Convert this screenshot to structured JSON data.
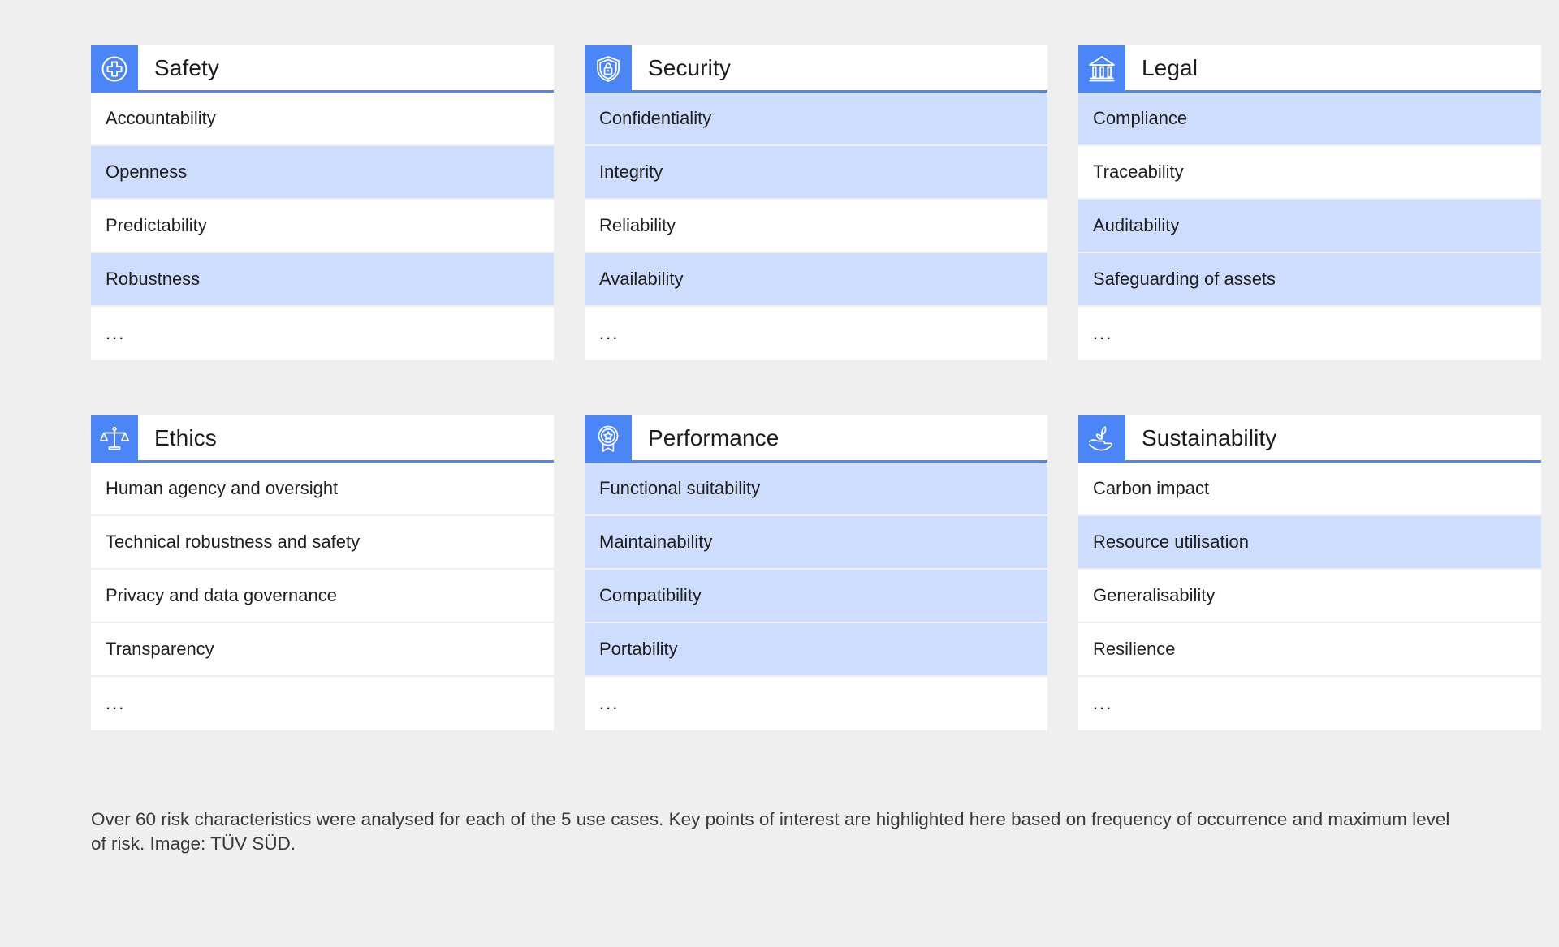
{
  "theme": {
    "background": "#efefef",
    "accent_blue": "#4a86f7",
    "highlight_row": "#cedcfd",
    "row_background": "#ffffff",
    "text": "#1f1f1f"
  },
  "cards": [
    {
      "title": "Safety",
      "icon": "shield-cross-circle-icon",
      "rows": [
        {
          "label": "Accountability",
          "highlighted": false
        },
        {
          "label": "Openness",
          "highlighted": true
        },
        {
          "label": "Predictability",
          "highlighted": false
        },
        {
          "label": "Robustness",
          "highlighted": true
        },
        {
          "label": "...",
          "highlighted": false
        }
      ]
    },
    {
      "title": "Security",
      "icon": "shield-lock-icon",
      "rows": [
        {
          "label": "Confidentiality",
          "highlighted": true
        },
        {
          "label": "Integrity",
          "highlighted": true
        },
        {
          "label": "Reliability",
          "highlighted": false
        },
        {
          "label": "Availability",
          "highlighted": true
        },
        {
          "label": "...",
          "highlighted": false
        }
      ]
    },
    {
      "title": "Legal",
      "icon": "bank-building-icon",
      "rows": [
        {
          "label": "Compliance",
          "highlighted": true
        },
        {
          "label": "Traceability",
          "highlighted": false
        },
        {
          "label": "Auditability",
          "highlighted": true
        },
        {
          "label": "Safeguarding of assets",
          "highlighted": true
        },
        {
          "label": "...",
          "highlighted": false
        }
      ]
    },
    {
      "title": "Ethics",
      "icon": "balance-scales-icon",
      "rows": [
        {
          "label": "Human agency and oversight",
          "highlighted": false
        },
        {
          "label": "Technical robustness and safety",
          "highlighted": false
        },
        {
          "label": "Privacy and data governance",
          "highlighted": false
        },
        {
          "label": "Transparency",
          "highlighted": false
        },
        {
          "label": "...",
          "highlighted": false
        }
      ]
    },
    {
      "title": "Performance",
      "icon": "award-medal-icon",
      "rows": [
        {
          "label": "Functional suitability",
          "highlighted": true
        },
        {
          "label": "Maintainability",
          "highlighted": true
        },
        {
          "label": "Compatibility",
          "highlighted": true
        },
        {
          "label": "Portability",
          "highlighted": true
        },
        {
          "label": "...",
          "highlighted": false
        }
      ]
    },
    {
      "title": "Sustainability",
      "icon": "hand-plant-icon",
      "rows": [
        {
          "label": "Carbon impact",
          "highlighted": false
        },
        {
          "label": "Resource utilisation",
          "highlighted": true
        },
        {
          "label": "Generalisability",
          "highlighted": false
        },
        {
          "label": "Resilience",
          "highlighted": false
        },
        {
          "label": "...",
          "highlighted": false
        }
      ]
    }
  ],
  "caption": {
    "text": "Over 60 risk characteristics were analysed for each of the 5 use cases. Key points of interest are highlighted here based on frequency of occurrence and maximum level of risk. Image: TÜV SÜD."
  }
}
